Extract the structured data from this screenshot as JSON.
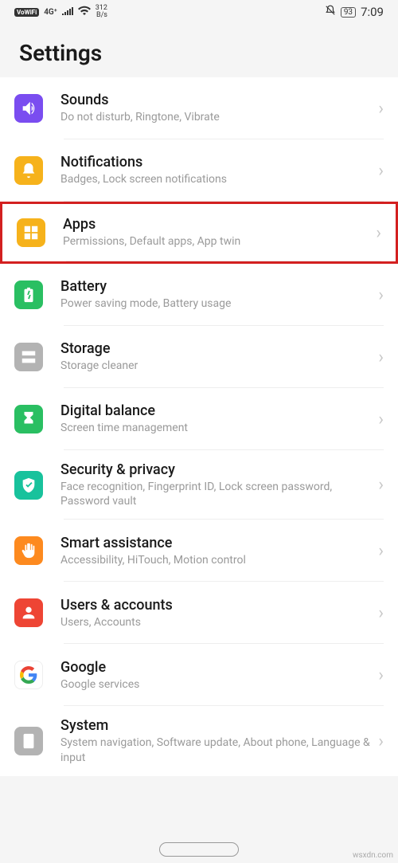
{
  "status": {
    "vowifi": "VoWiFi",
    "signal": "4G⁺",
    "speed_num": "312",
    "speed_unit": "B/s",
    "battery": "93",
    "time": "7:09"
  },
  "header": {
    "title": "Settings"
  },
  "rows": [
    {
      "id": "sounds",
      "title": "Sounds",
      "sub": "Do not disturb, Ringtone, Vibrate",
      "color": "ic-purple",
      "icon": "volume",
      "highlight": false
    },
    {
      "id": "notifications",
      "title": "Notifications",
      "sub": "Badges, Lock screen notifications",
      "color": "ic-yellow",
      "icon": "bell",
      "highlight": false
    },
    {
      "id": "apps",
      "title": "Apps",
      "sub": "Permissions, Default apps, App twin",
      "color": "ic-yellow",
      "icon": "grid",
      "highlight": true
    },
    {
      "id": "battery",
      "title": "Battery",
      "sub": "Power saving mode, Battery usage",
      "color": "ic-green",
      "icon": "battery",
      "highlight": false
    },
    {
      "id": "storage",
      "title": "Storage",
      "sub": "Storage cleaner",
      "color": "ic-grey",
      "icon": "storage",
      "highlight": false
    },
    {
      "id": "digital-balance",
      "title": "Digital balance",
      "sub": "Screen time management",
      "color": "ic-green",
      "icon": "hourglass",
      "highlight": false
    },
    {
      "id": "security",
      "title": "Security & privacy",
      "sub": "Face recognition, Fingerprint ID, Lock screen password, Password vault",
      "color": "ic-teal",
      "icon": "shield",
      "highlight": false
    },
    {
      "id": "smart-assistance",
      "title": "Smart assistance",
      "sub": "Accessibility, HiTouch, Motion control",
      "color": "ic-orange",
      "icon": "hand",
      "highlight": false
    },
    {
      "id": "users",
      "title": "Users & accounts",
      "sub": "Users, Accounts",
      "color": "ic-red",
      "icon": "user",
      "highlight": false
    },
    {
      "id": "google",
      "title": "Google",
      "sub": "Google services",
      "color": "ic-white",
      "icon": "google",
      "highlight": false
    },
    {
      "id": "system",
      "title": "System",
      "sub": "System navigation, Software update, About phone, Language & input",
      "color": "ic-grey",
      "icon": "phoneinfo",
      "highlight": false
    }
  ],
  "watermark": "wsxdn.com"
}
